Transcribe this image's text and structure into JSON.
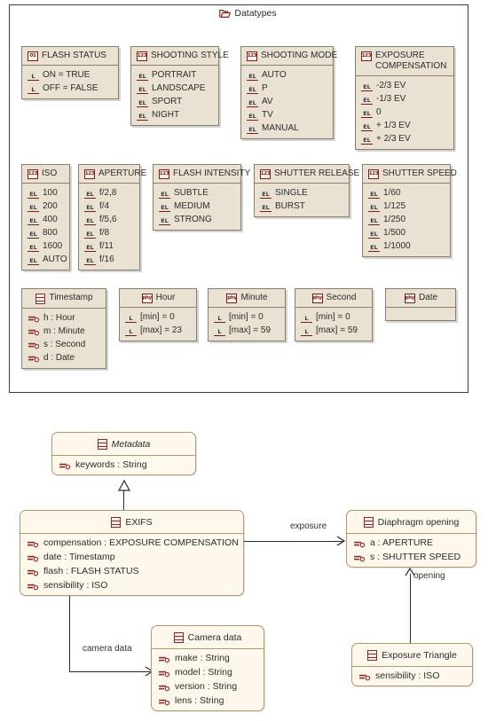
{
  "package": {
    "title": "Datatypes",
    "icon": "folder-icon"
  },
  "colors": {
    "datatype_fill": "#e9e1d1",
    "datatype_border": "#8a7f6b",
    "class_fill": "#fdf7ec",
    "class_border": "#b09a6e",
    "icon_red": "#7d1b16",
    "frame": "#3c3c40"
  },
  "datatypes": [
    {
      "name": "FLASH STATUS",
      "icon": "enum-01-icon",
      "literal_icon": "literal-L-icon",
      "literals": [
        "ON = TRUE",
        "OFF = FALSE"
      ]
    },
    {
      "name": "SHOOTING STYLE",
      "icon": "enum-123-icon",
      "literal_icon": "literal-EL-icon",
      "literals": [
        "PORTRAIT",
        "LANDSCAPE",
        "SPORT",
        "NIGHT"
      ]
    },
    {
      "name": "SHOOTING MODE",
      "icon": "enum-123-icon",
      "literal_icon": "literal-EL-icon",
      "literals": [
        "AUTO",
        "P",
        "AV",
        "TV",
        "MANUAL"
      ]
    },
    {
      "name": "EXPOSURE COMPENSATION",
      "icon": "enum-123-icon",
      "literal_icon": "literal-EL-icon",
      "literals": [
        "-2/3 EV",
        "-1/3 EV",
        "0",
        "+ 1/3 EV",
        "+ 2/3 EV"
      ]
    },
    {
      "name": "ISO",
      "icon": "enum-123-icon",
      "literal_icon": "literal-EL-icon",
      "literals": [
        "100",
        "200",
        "400",
        "800",
        "1600",
        "AUTO"
      ]
    },
    {
      "name": "APERTURE",
      "icon": "enum-123-icon",
      "literal_icon": "literal-EL-icon",
      "literals": [
        "f/2,8",
        "f/4",
        "f/5,6",
        "f/8",
        "f/11",
        "f/16"
      ]
    },
    {
      "name": "FLASH INTENSITY",
      "icon": "enum-123-icon",
      "literal_icon": "literal-EL-icon",
      "literals": [
        "SUBTLE",
        "MEDIUM",
        "STRONG"
      ]
    },
    {
      "name": "SHUTTER RELEASE",
      "icon": "enum-123-icon",
      "literal_icon": "literal-EL-icon",
      "literals": [
        "SINGLE",
        "BURST"
      ]
    },
    {
      "name": "SHUTTER SPEED",
      "icon": "enum-123-icon",
      "literal_icon": "literal-EL-icon",
      "literals": [
        "1/60",
        "1/125",
        "1/250",
        "1/500",
        "1/1000"
      ]
    },
    {
      "name": "Timestamp",
      "icon": "class-icon",
      "literal_icon": "attribute-icon",
      "literals": [
        "h : Hour",
        "m : Minute",
        "s : Second",
        "d : Date"
      ]
    },
    {
      "name": "Hour",
      "icon": "phy-icon",
      "literal_icon": "literal-L-icon",
      "literals": [
        "[min]  = 0",
        "[max]  = 23"
      ]
    },
    {
      "name": "Minute",
      "icon": "phy-icon",
      "literal_icon": "literal-L-icon",
      "literals": [
        "[min]  = 0",
        "[max]  = 59"
      ]
    },
    {
      "name": "Second",
      "icon": "phy-icon",
      "literal_icon": "literal-L-icon",
      "literals": [
        "[min]  = 0",
        "[max]  = 59"
      ]
    },
    {
      "name": "Date",
      "icon": "phy-icon",
      "literal_icon": "",
      "literals": []
    }
  ],
  "classes": [
    {
      "name": "Metadata",
      "abstract": true,
      "icon": "class-icon",
      "attributes": [
        "keywords : String"
      ]
    },
    {
      "name": "EXIFS",
      "abstract": false,
      "icon": "class-icon",
      "attributes": [
        "compensation : EXPOSURE COMPENSATION",
        "date : Timestamp",
        "flash : FLASH STATUS",
        "sensibility : ISO"
      ]
    },
    {
      "name": "Diaphragm opening",
      "abstract": false,
      "icon": "class-icon",
      "attributes": [
        "a : APERTURE",
        "s : SHUTTER SPEED"
      ]
    },
    {
      "name": "Camera data",
      "abstract": false,
      "icon": "class-icon",
      "attributes": [
        "make : String",
        "model : String",
        "version : String",
        "lens : String"
      ]
    },
    {
      "name": "Exposure Triangle",
      "abstract": false,
      "icon": "class-icon",
      "attributes": [
        "sensibility : ISO"
      ]
    }
  ],
  "relationships": [
    {
      "label": "exposure",
      "from": "EXIFS",
      "to": "Diaphragm opening",
      "kind": "association"
    },
    {
      "label": "camera data",
      "from": "EXIFS",
      "to": "Camera data",
      "kind": "association"
    },
    {
      "label": "opening",
      "from": "Exposure Triangle",
      "to": "Diaphragm opening",
      "kind": "association"
    },
    {
      "label": "",
      "from": "EXIFS",
      "to": "Metadata",
      "kind": "generalization"
    }
  ]
}
